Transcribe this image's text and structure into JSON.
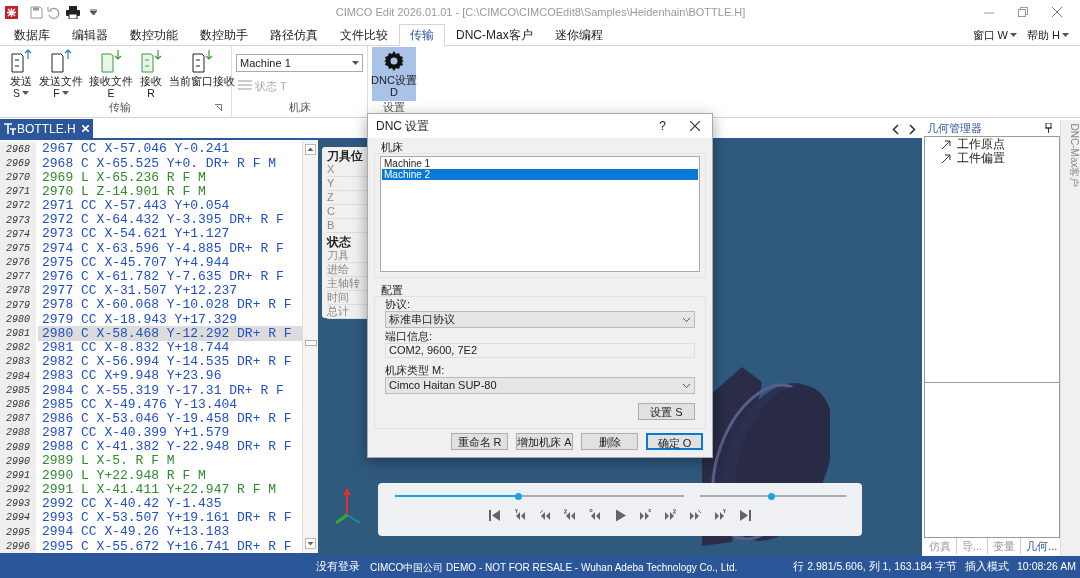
{
  "title_bar": {
    "title": "CIMCO Edit 2026.01.01 - [C:\\CIMCO\\CIMCOEdit8\\Samples\\Heidenhain\\BOTTLE.H]"
  },
  "ribbon_tabs": [
    {
      "label": "数据库",
      "selected": false
    },
    {
      "label": "编辑器",
      "selected": false
    },
    {
      "label": "数控功能",
      "selected": false
    },
    {
      "label": "数控助手",
      "selected": false
    },
    {
      "label": "路径仿真",
      "selected": false
    },
    {
      "label": "文件比较",
      "selected": false
    },
    {
      "label": "传输",
      "selected": true
    },
    {
      "label": "DNC-Max客户",
      "selected": false
    },
    {
      "label": "迷你编程",
      "selected": false
    }
  ],
  "ribbon_menus": [
    {
      "label": "窗口 W"
    },
    {
      "label": "帮助 H"
    }
  ],
  "transfer_group": {
    "label": "传输",
    "buttons": [
      {
        "label": "发送",
        "key": "S",
        "kind": "send",
        "dropdown": true
      },
      {
        "label": "发送文件",
        "key": "F",
        "kind": "send",
        "dropdown": true
      },
      {
        "label": "接收文件",
        "key": "E",
        "kind": "receive",
        "dropdown": false
      },
      {
        "label": "接收",
        "key": "R",
        "kind": "receive",
        "dropdown": false
      },
      {
        "label": "当前窗口接收",
        "kind": "receive",
        "dropdown": false
      }
    ]
  },
  "machine_group": {
    "label": "机床",
    "machine": "Machine 1",
    "status_button": {
      "label": "状态 T",
      "disabled": true
    }
  },
  "settings_group": {
    "label": "设置",
    "button": {
      "label": "DNC设置",
      "key": "D",
      "selected": true
    }
  },
  "editor": {
    "tab": "BOTTLE.H",
    "lines": [
      {
        "number": "2968",
        "code": "2967 CC X-57.046 Y-0.241",
        "color": "#1f4fc9",
        "selected": false
      },
      {
        "number": "2969",
        "code": "2968 C X-65.525 Y+0. DR+ R F M",
        "color": "#1f4fc9",
        "selected": false
      },
      {
        "number": "2970",
        "code": "2969 L X-65.236 R F M",
        "color": "#2e8b2e",
        "selected": false
      },
      {
        "number": "2971",
        "code": "2970 L Z-14.901 R F M",
        "color": "#2e8b2e",
        "selected": false
      },
      {
        "number": "2972",
        "code": "2971 CC X-57.443 Y+0.054",
        "color": "#1f4fc9",
        "selected": false
      },
      {
        "number": "2973",
        "code": "2972 C X-64.432 Y-3.395 DR+ R F",
        "color": "#1f4fc9",
        "selected": false
      },
      {
        "number": "2974",
        "code": "2973 CC X-54.621 Y+1.127",
        "color": "#1f4fc9",
        "selected": false
      },
      {
        "number": "2975",
        "code": "2974 C X-63.596 Y-4.885 DR+ R F",
        "color": "#1f4fc9",
        "selected": false
      },
      {
        "number": "2976",
        "code": "2975 CC X-45.707 Y+4.944",
        "color": "#1f4fc9",
        "selected": false
      },
      {
        "number": "2977",
        "code": "2976 C X-61.782 Y-7.635 DR+ R F",
        "color": "#1f4fc9",
        "selected": false
      },
      {
        "number": "2978",
        "code": "2977 CC X-31.507 Y+12.237",
        "color": "#1f4fc9",
        "selected": false
      },
      {
        "number": "2979",
        "code": "2978 C X-60.068 Y-10.028 DR+ R F",
        "color": "#1f4fc9",
        "selected": false
      },
      {
        "number": "2980",
        "code": "2979 CC X-18.943 Y+17.329",
        "color": "#1f4fc9",
        "selected": false
      },
      {
        "number": "2981",
        "code": "2980 C X-58.468 Y-12.292 DR+ R F",
        "color": "#1f4fc9",
        "selected": true
      },
      {
        "number": "2982",
        "code": "2981 CC X-8.832 Y+18.744",
        "color": "#1f4fc9",
        "selected": false
      },
      {
        "number": "2983",
        "code": "2982 C X-56.994 Y-14.535 DR+ R F",
        "color": "#1f4fc9",
        "selected": false
      },
      {
        "number": "2984",
        "code": "2983 CC X+9.948 Y+23.96",
        "color": "#1f4fc9",
        "selected": false
      },
      {
        "number": "2985",
        "code": "2984 C X-55.319 Y-17.31 DR+ R F",
        "color": "#1f4fc9",
        "selected": false
      },
      {
        "number": "2986",
        "code": "2985 CC X-49.476 Y-13.404",
        "color": "#1f4fc9",
        "selected": false
      },
      {
        "number": "2987",
        "code": "2986 C X-53.046 Y-19.458 DR+ R F",
        "color": "#1f4fc9",
        "selected": false
      },
      {
        "number": "2988",
        "code": "2987 CC X-40.399 Y+1.579",
        "color": "#1f4fc9",
        "selected": false
      },
      {
        "number": "2989",
        "code": "2988 C X-41.382 Y-22.948 DR+ R F",
        "color": "#1f4fc9",
        "selected": false
      },
      {
        "number": "2990",
        "code": "2989 L X-5. R F M",
        "color": "#2e8b2e",
        "selected": false
      },
      {
        "number": "2991",
        "code": "2990 L Y+22.948 R F M",
        "color": "#2e8b2e",
        "selected": false
      },
      {
        "number": "2992",
        "code": "2991 L X-41.411 Y+22.947 R F M",
        "color": "#2e8b2e",
        "selected": false
      },
      {
        "number": "2993",
        "code": "2992 CC X-40.42 Y-1.435",
        "color": "#1f4fc9",
        "selected": false
      },
      {
        "number": "2994",
        "code": "2993 C X-53.507 Y+19.161 DR+ R F",
        "color": "#1f4fc9",
        "selected": false
      },
      {
        "number": "2995",
        "code": "2994 CC X-49.26 Y+13.183",
        "color": "#1f4fc9",
        "selected": false
      },
      {
        "number": "2996",
        "code": "2995 C X-55.672 Y+16.741 DR+ R F",
        "color": "#1f4fc9",
        "selected": false
      }
    ]
  },
  "viewport": {
    "tool_panel": {
      "title": "刀具位",
      "axes": [
        "X",
        "Y",
        "Z",
        "C",
        "B"
      ],
      "status_title": "状态",
      "status_items": [
        "刀具",
        "进给",
        "主轴转",
        "时间",
        "总计"
      ]
    },
    "player": {
      "sliders": [
        {
          "level": 0.43
        },
        {
          "level": 0.49
        }
      ]
    }
  },
  "dialog": {
    "title": "DNC 设置",
    "help": "?",
    "machines_label": "机床",
    "machines": [
      {
        "label": "Machine 1",
        "selected": false
      },
      {
        "label": "Machine 2",
        "selected": true
      }
    ],
    "config_label": "配置",
    "protocol_label": "协议:",
    "protocol": "标准串口协议",
    "port_label": "端口信息:",
    "port": "COM2, 9600, 7E2",
    "type_label": "机床类型 M:",
    "type": "Cimco Haitan SUP-80",
    "setup_button": "设置 S",
    "buttons": [
      {
        "label": "重命名 R",
        "default": false
      },
      {
        "label": "增加机床 A",
        "default": false
      },
      {
        "label": "删除",
        "default": false
      },
      {
        "label": "确定 O",
        "default": true
      }
    ]
  },
  "right_panel": {
    "title": "几何管理器",
    "tree": [
      "工作原点",
      "工件偏置"
    ],
    "tabs": [
      {
        "label": "仿真",
        "selected": false
      },
      {
        "label": "导...",
        "selected": false
      },
      {
        "label": "变量",
        "selected": false
      },
      {
        "label": "几何...",
        "selected": true
      }
    ]
  },
  "side_strip": {
    "label": "DNC-Max客户"
  },
  "status_bar": {
    "login": "没有登录",
    "license": "CIMCO中国公司 DEMO - NOT FOR RESALE - Wuhan Adeba Technology Co., Ltd.",
    "position": "行 2.981/5.606, 列 1, 163.184 字节",
    "mode": "插入模式",
    "time": "10:08:26 AM"
  }
}
